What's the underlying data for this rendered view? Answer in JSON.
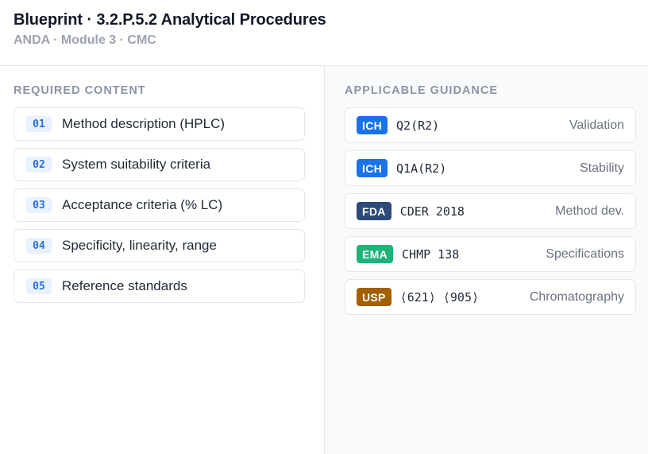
{
  "header": {
    "title": "Blueprint · 3.2.P.5.2 Analytical Procedures",
    "subtitle": "ANDA · Module 3 · CMC"
  },
  "required": {
    "label": "REQUIRED CONTENT",
    "items": [
      {
        "num": "01",
        "text": "Method description (HPLC)"
      },
      {
        "num": "02",
        "text": "System suitability criteria"
      },
      {
        "num": "03",
        "text": "Acceptance criteria (% LC)"
      },
      {
        "num": "04",
        "text": "Specificity, linearity, range"
      },
      {
        "num": "05",
        "text": "Reference standards"
      }
    ]
  },
  "guidance": {
    "label": "APPLICABLE GUIDANCE",
    "items": [
      {
        "agency": "ICH",
        "color": "#1a73e8",
        "code": "Q2(R2)",
        "topic": "Validation"
      },
      {
        "agency": "ICH",
        "color": "#1a73e8",
        "code": "Q1A(R2)",
        "topic": "Stability"
      },
      {
        "agency": "FDA",
        "color": "#2c4a7a",
        "code": "CDER 2018",
        "topic": "Method dev."
      },
      {
        "agency": "EMA",
        "color": "#1fb37a",
        "code": "CHMP 138",
        "topic": "Specifications"
      },
      {
        "agency": "USP",
        "color": "#a35f00",
        "code": "⟨621⟩ ⟨905⟩",
        "topic": "Chromatography"
      }
    ]
  }
}
